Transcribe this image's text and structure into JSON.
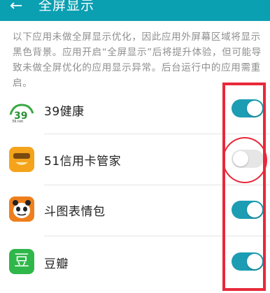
{
  "header": {
    "back_glyph": "←",
    "title": "全屏显示"
  },
  "description": "以下应用未做全屏显示优化，因此应用外屏幕区域将显示黑色背景。应用开启“全屏显示”后将提升体验，但可能导致未做全屏优化的应用显示异常。后台运行中的应用需重启。",
  "apps": [
    {
      "name": "39健康",
      "icon": "39-health-app-icon",
      "enabled": true
    },
    {
      "name": "51信用卡管家",
      "icon": "51-credit-card-app-icon",
      "enabled": false
    },
    {
      "name": "斗图表情包",
      "icon": "doutu-emoji-app-icon",
      "enabled": true
    },
    {
      "name": "豆瓣",
      "icon": "douban-app-icon",
      "enabled": true,
      "icon_text": "豆"
    }
  ],
  "colors": {
    "accent": "#0b9fb2",
    "toggle_on": "#1c9db3",
    "annotation": "#e8293a"
  }
}
